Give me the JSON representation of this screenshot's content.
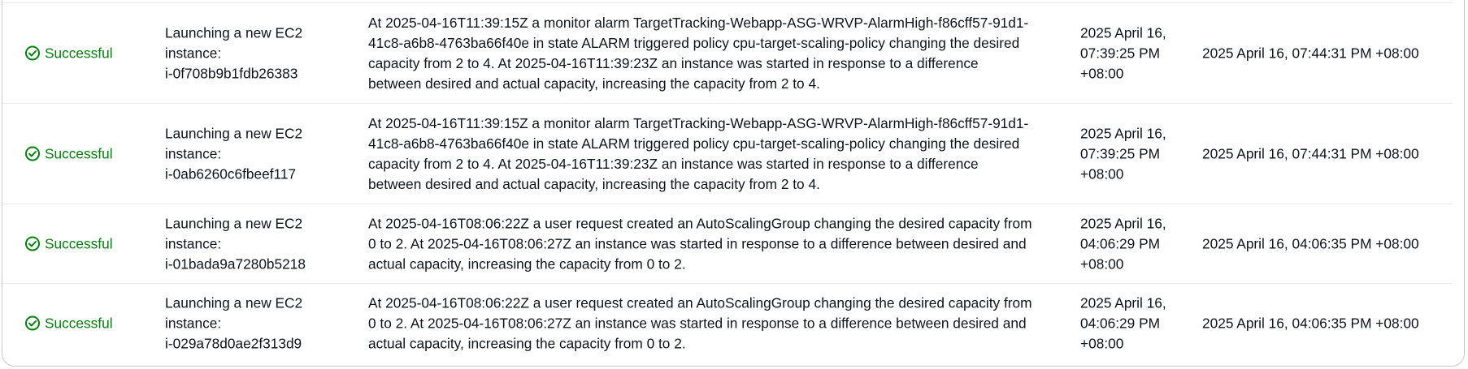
{
  "activity_table": {
    "rows": [
      {
        "status": "Successful",
        "description": [
          "Launching a new EC2",
          "instance:",
          "i-0f708b9b1fdb26383"
        ],
        "cause": "At 2025-04-16T11:39:15Z a monitor alarm TargetTracking-Webapp-ASG-WRVP-AlarmHigh-f86cff57-91d1-41c8-a6b8-4763ba66f40e in state ALARM triggered policy cpu-target-scaling-policy changing the desired capacity from 2 to 4. At 2025-04-16T11:39:23Z an instance was started in response to a difference between desired and actual capacity, increasing the capacity from 2 to 4.",
        "start_time": "2025 April 16, 07:39:25 PM +08:00",
        "end_time": "2025 April 16, 07:44:31 PM +08:00"
      },
      {
        "status": "Successful",
        "description": [
          "Launching a new EC2",
          "instance:",
          "i-0ab6260c6fbeef117"
        ],
        "cause": "At 2025-04-16T11:39:15Z a monitor alarm TargetTracking-Webapp-ASG-WRVP-AlarmHigh-f86cff57-91d1-41c8-a6b8-4763ba66f40e in state ALARM triggered policy cpu-target-scaling-policy changing the desired capacity from 2 to 4. At 2025-04-16T11:39:23Z an instance was started in response to a difference between desired and actual capacity, increasing the capacity from 2 to 4.",
        "start_time": "2025 April 16, 07:39:25 PM +08:00",
        "end_time": "2025 April 16, 07:44:31 PM +08:00"
      },
      {
        "status": "Successful",
        "description": [
          "Launching a new EC2",
          "instance:",
          "i-01bada9a7280b5218"
        ],
        "cause": "At 2025-04-16T08:06:22Z a user request created an AutoScalingGroup changing the desired capacity from 0 to 2. At 2025-04-16T08:06:27Z an instance was started in response to a difference between desired and actual capacity, increasing the capacity from 0 to 2.",
        "start_time": "2025 April 16, 04:06:29 PM +08:00",
        "end_time": "2025 April 16, 04:06:35 PM +08:00"
      },
      {
        "status": "Successful",
        "description": [
          "Launching a new EC2",
          "instance:",
          "i-029a78d0ae2f313d9"
        ],
        "cause": "At 2025-04-16T08:06:22Z a user request created an AutoScalingGroup changing the desired capacity from 0 to 2. At 2025-04-16T08:06:27Z an instance was started in response to a difference between desired and actual capacity, increasing the capacity from 0 to 2.",
        "start_time": "2025 April 16, 04:06:29 PM +08:00",
        "end_time": "2025 April 16, 04:06:35 PM +08:00"
      }
    ]
  },
  "colors": {
    "success": "#037f0c",
    "text": "#0f141a",
    "border": "#c6c6cd"
  },
  "icons": {
    "status": "status-success-icon"
  }
}
